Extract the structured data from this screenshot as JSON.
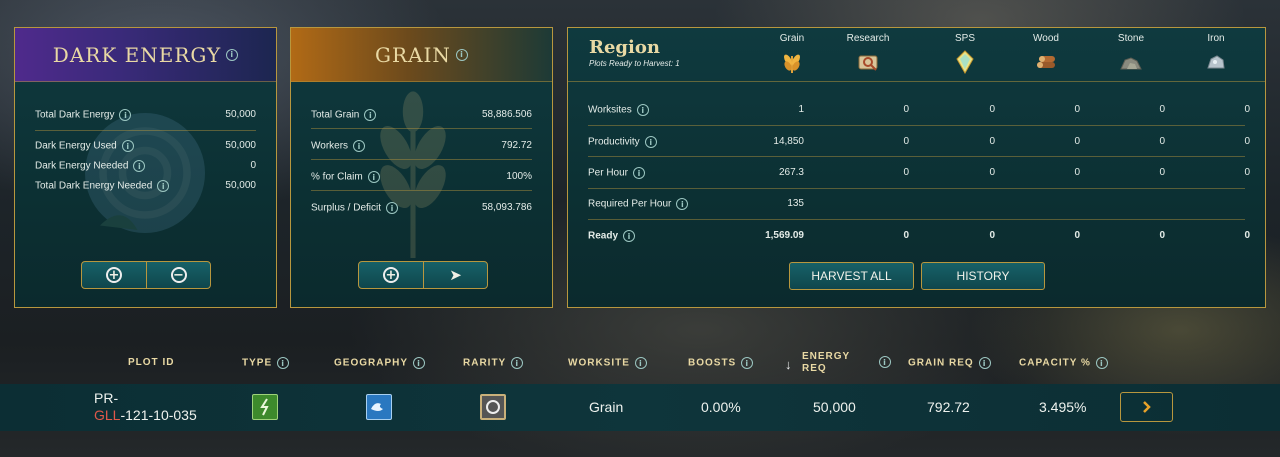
{
  "dark_energy": {
    "title": "DARK ENERGY",
    "rows": [
      {
        "label": "Total Dark Energy",
        "value": "50,000"
      },
      {
        "label": "Dark Energy Used",
        "value": "50,000"
      },
      {
        "label": "Dark Energy Needed",
        "value": "0"
      },
      {
        "label": "Total Dark Energy Needed",
        "value": "50,000"
      }
    ],
    "buttons": {
      "add": "+",
      "remove": "−"
    }
  },
  "grain": {
    "title": "GRAIN",
    "rows": [
      {
        "label": "Total Grain",
        "value": "58,886.506"
      },
      {
        "label": "Workers",
        "value": "792.72"
      },
      {
        "label": "% for Claim",
        "value": "100%"
      },
      {
        "label": "Surplus / Deficit",
        "value": "58,093.786"
      }
    ],
    "buttons": {
      "add": "+",
      "send": "➤"
    }
  },
  "region": {
    "title": "Region",
    "subtitle": "Plots Ready to Harvest: 1",
    "resources": [
      {
        "name": "Grain",
        "icon": "grain-icon"
      },
      {
        "name": "Research",
        "icon": "research-icon"
      },
      {
        "name": "SPS",
        "icon": "sps-icon"
      },
      {
        "name": "Wood",
        "icon": "wood-icon"
      },
      {
        "name": "Stone",
        "icon": "stone-icon"
      },
      {
        "name": "Iron",
        "icon": "iron-icon"
      }
    ],
    "rows": [
      {
        "label": "Worksites",
        "values": [
          "1",
          "0",
          "0",
          "0",
          "0",
          "0"
        ]
      },
      {
        "label": "Productivity",
        "values": [
          "14,850",
          "0",
          "0",
          "0",
          "0",
          "0"
        ]
      },
      {
        "label": "Per Hour",
        "values": [
          "267.3",
          "0",
          "0",
          "0",
          "0",
          "0"
        ]
      },
      {
        "label": "Required Per Hour",
        "values": [
          "135",
          "",
          "",
          "",
          "",
          ""
        ]
      },
      {
        "label": "Ready",
        "values": [
          "1,569.09",
          "0",
          "0",
          "0",
          "0",
          "0"
        ]
      }
    ],
    "harvest_all_label": "HARVEST ALL",
    "history_label": "HISTORY"
  },
  "table": {
    "headers": {
      "plot_id": "PLOT ID",
      "type": "TYPE",
      "geography": "GEOGRAPHY",
      "rarity": "RARITY",
      "worksite": "WORKSITE",
      "boosts": "BOOSTS",
      "energy_req_1": "ENERGY",
      "energy_req_2": "REQ",
      "grain_req": "GRAIN REQ",
      "capacity": "CAPACITY %"
    },
    "sort_arrow": "↓",
    "row": {
      "plot_prefix": "PR-",
      "plot_code": "GLL",
      "plot_suffix": "-121-10-035",
      "worksite": "Grain",
      "boosts": "0.00%",
      "energy_req": "50,000",
      "grain_req": "792.72",
      "capacity": "3.495%"
    }
  },
  "colors": {
    "gold": "#b8973e",
    "title_gold": "#e9d9a4",
    "panel_teal": "#0c3033",
    "plot_code_red": "#e0584a",
    "type_green": "#3d8a2c",
    "geo_blue": "#2a78c0"
  }
}
